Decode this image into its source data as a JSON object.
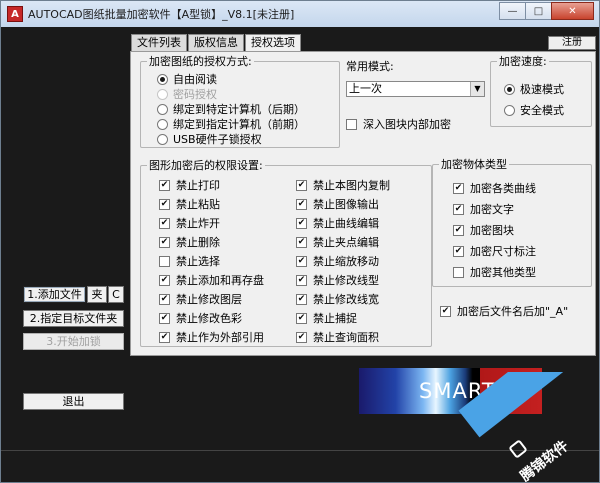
{
  "window": {
    "title": "AUTOCAD图纸批量加密软件【A型锁】_V8.1[未注册]",
    "icon_glyph": "A",
    "min_label": "—",
    "max_label": "□",
    "close_label": "✕"
  },
  "tabs": [
    {
      "label": "文件列表",
      "active": false
    },
    {
      "label": "版权信息",
      "active": false
    },
    {
      "label": "授权选项",
      "active": true
    }
  ],
  "register_label": "注册",
  "auth_group": {
    "legend": "加密图纸的授权方式:",
    "options": [
      {
        "label": "自由阅读",
        "selected": true,
        "disabled": false
      },
      {
        "label": "密码授权",
        "selected": false,
        "disabled": true
      },
      {
        "label": "绑定到特定计算机（后期）",
        "selected": false,
        "disabled": false
      },
      {
        "label": "绑定到指定计算机（前期）",
        "selected": false,
        "disabled": false
      },
      {
        "label": "USB硬件子锁授权",
        "selected": false,
        "disabled": false
      }
    ]
  },
  "common_mode": {
    "label": "常用模式:",
    "value": "上一次",
    "arrow": "▼"
  },
  "deep_encrypt": {
    "label": "深入图块内部加密",
    "checked": false
  },
  "speed_group": {
    "legend": "加密速度:",
    "options": [
      {
        "label": "极速模式",
        "selected": true
      },
      {
        "label": "安全模式",
        "selected": false
      }
    ]
  },
  "perm_group": {
    "legend": "图形加密后的权限设置:",
    "col1": [
      {
        "label": "禁止打印",
        "checked": true
      },
      {
        "label": "禁止粘贴",
        "checked": true
      },
      {
        "label": "禁止炸开",
        "checked": true
      },
      {
        "label": "禁止删除",
        "checked": true
      },
      {
        "label": "禁止选择",
        "checked": false
      },
      {
        "label": "禁止添加和再存盘",
        "checked": true
      },
      {
        "label": "禁止修改图层",
        "checked": true
      },
      {
        "label": "禁止修改色彩",
        "checked": true
      },
      {
        "label": "禁止作为外部引用",
        "checked": true
      }
    ],
    "col2": [
      {
        "label": "禁止本图内复制",
        "checked": true
      },
      {
        "label": "禁止图像输出",
        "checked": true
      },
      {
        "label": "禁止曲线编辑",
        "checked": true
      },
      {
        "label": "禁止夹点编辑",
        "checked": true
      },
      {
        "label": "禁止缩放移动",
        "checked": true
      },
      {
        "label": "禁止修改线型",
        "checked": true
      },
      {
        "label": "禁止修改线宽",
        "checked": true
      },
      {
        "label": "禁止捕捉",
        "checked": true
      },
      {
        "label": "禁止查询面积",
        "checked": true
      }
    ]
  },
  "object_group": {
    "legend": "加密物体类型",
    "items": [
      {
        "label": "加密各类曲线",
        "checked": true
      },
      {
        "label": "加密文字",
        "checked": true
      },
      {
        "label": "加密图块",
        "checked": true
      },
      {
        "label": "加密尺寸标注",
        "checked": true
      },
      {
        "label": "加密其他类型",
        "checked": false
      }
    ]
  },
  "suffix_option": {
    "label": "加密后文件名后加\"_A\"",
    "checked": true
  },
  "side_buttons": {
    "add_file": "1.添加文件",
    "add_folder": "夹",
    "clear": "C",
    "target_folder": "2.指定目标文件夹",
    "start": "3.开始加锁",
    "exit": "退出"
  },
  "logo_text": "SMARTLO",
  "watermark_text": "腾锦软件",
  "colors": {
    "accent_blue": "#4aa3e6",
    "logo_red": "#c42020",
    "background": "#1a1a1a"
  }
}
